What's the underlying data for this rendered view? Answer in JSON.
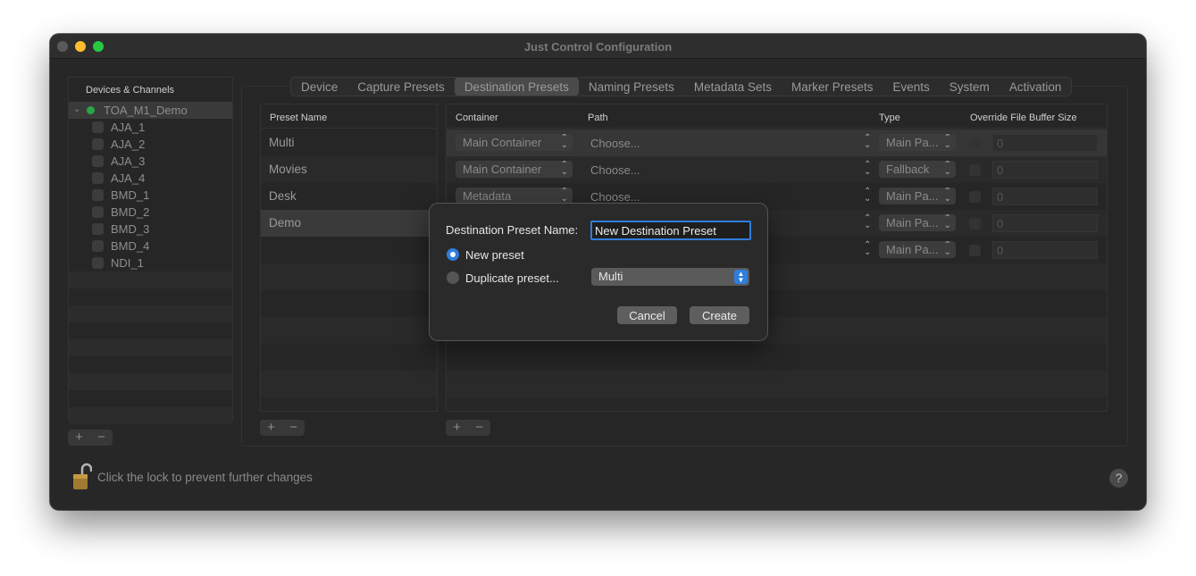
{
  "window": {
    "title": "Just Control Configuration"
  },
  "sidebar": {
    "header": "Devices & Channels",
    "root": {
      "label": "TOA_M1_Demo"
    },
    "channels": [
      "AJA_1",
      "AJA_2",
      "AJA_3",
      "AJA_4",
      "BMD_1",
      "BMD_2",
      "BMD_3",
      "BMD_4",
      "NDI_1"
    ],
    "add_label": "+",
    "remove_label": "−"
  },
  "tabs": [
    "Device",
    "Capture Presets",
    "Destination Presets",
    "Naming Presets",
    "Metadata Sets",
    "Marker Presets",
    "Events",
    "System",
    "Activation"
  ],
  "active_tab": "Destination Presets",
  "preset_list": {
    "header": "Preset Name",
    "items": [
      "Multi",
      "Movies",
      "Desk",
      "Demo"
    ],
    "selected": "Demo",
    "add_label": "+",
    "remove_label": "−"
  },
  "destination_table": {
    "headers": {
      "container": "Container",
      "path": "Path",
      "type": "Type",
      "buffer": "Override File Buffer Size"
    },
    "rows": [
      {
        "container": "Main Container",
        "path": "Choose...",
        "type": "Main Pa...",
        "buffer": "0"
      },
      {
        "container": "Main Container",
        "path": "Choose...",
        "type": "Fallback",
        "buffer": "0"
      },
      {
        "container": "Metadata",
        "path": "Choose...",
        "type": "Main Pa...",
        "buffer": "0"
      },
      {
        "container": "",
        "path": "",
        "type": "Main Pa...",
        "buffer": "0"
      },
      {
        "container": "",
        "path": "",
        "type": "Main Pa...",
        "buffer": "0"
      }
    ],
    "add_label": "+",
    "remove_label": "−"
  },
  "footer": {
    "lock_text": "Click the lock to prevent further changes",
    "help_label": "?"
  },
  "dialog": {
    "name_label": "Destination Preset Name:",
    "name_value": "New Destination Preset",
    "option_new": "New preset",
    "option_duplicate": "Duplicate preset...",
    "duplicate_source": "Multi",
    "cancel_label": "Cancel",
    "create_label": "Create"
  },
  "colors": {
    "accent": "#2f7ddc",
    "status_green": "#28a745"
  }
}
